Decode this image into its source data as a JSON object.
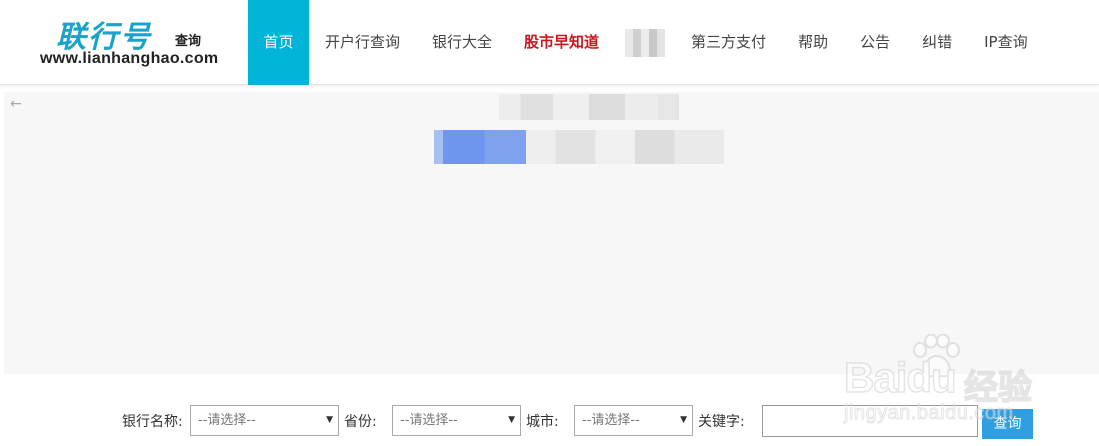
{
  "logo": {
    "main": "联行号",
    "sub": "查询",
    "url": "www.lianhanghao.com"
  },
  "nav": {
    "items": [
      {
        "label": "首页"
      },
      {
        "label": "开户行查询"
      },
      {
        "label": "银行大全"
      },
      {
        "label": "股市早知道"
      },
      {
        "label": "第三方支付"
      },
      {
        "label": "帮助"
      },
      {
        "label": "公告"
      },
      {
        "label": "纠错"
      },
      {
        "label": "IP查询"
      }
    ]
  },
  "icons": {
    "back": "back-arrow-icon",
    "dropdown": "dropdown-arrow-icon"
  },
  "form": {
    "bank_label": "银行名称:",
    "province_label": "省份:",
    "city_label": "城市:",
    "keyword_label": "关键字:",
    "bank_value": "--请选择--",
    "province_value": "--请选择--",
    "city_value": "--请选择--",
    "keyword_value": "",
    "query_label": "查询"
  },
  "watermark": {
    "brand": "Baidu",
    "cn": "经验",
    "url": "jingyan.baidu.com"
  },
  "colors": {
    "accent": "#00b4d8",
    "hot": "#c9171e",
    "button": "#2e9fe0"
  }
}
